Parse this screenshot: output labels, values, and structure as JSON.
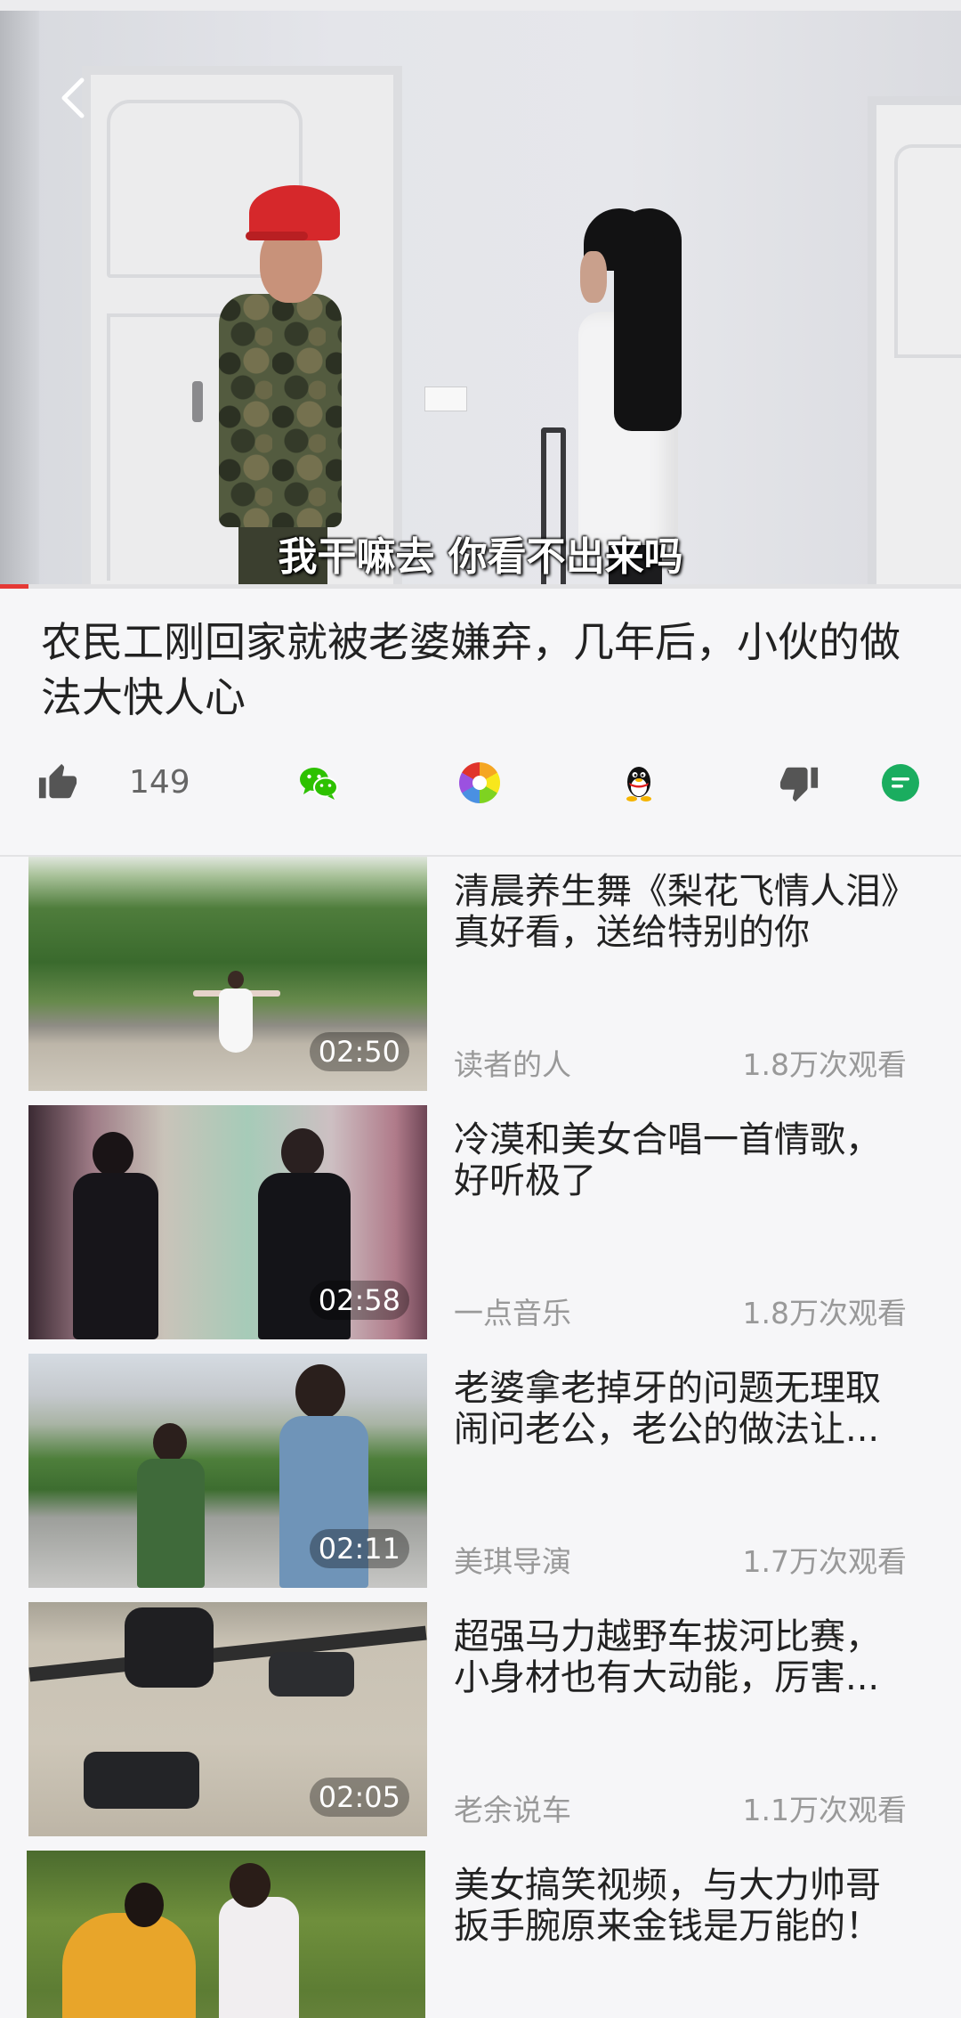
{
  "colors": {
    "accent": "#e53935",
    "wechat": "#2dc100",
    "comment": "#1aad5f",
    "title_text": "#222222",
    "meta_text": "#999999",
    "background": "#f6f6f8"
  },
  "player": {
    "back_icon": "chevron-left-icon",
    "subtitle": "我干嘛去 你看不出来吗",
    "progress": 0.03
  },
  "video": {
    "title": "农民工刚回家就被老婆嫌弃，几年后，小伙的做法大快人心",
    "like_count": "149"
  },
  "actions": {
    "like_icon": "thumbs-up-icon",
    "share_icons": [
      "wechat-icon",
      "moments-icon",
      "qq-icon"
    ],
    "dislike_icon": "thumbs-down-icon",
    "comment_icon": "comment-icon"
  },
  "related": [
    {
      "title": "清晨养生舞《梨花飞情人泪》真好看，送给特别的你",
      "author": "读者的人",
      "views": "1.8万次观看",
      "duration": "02:50"
    },
    {
      "title": "冷漠和美女合唱一首情歌，好听极了",
      "author": "一点音乐",
      "views": "1.8万次观看",
      "duration": "02:58"
    },
    {
      "title": "老婆拿老掉牙的问题无理取闹问老公，老公的做法让...",
      "author": "美琪导演",
      "views": "1.7万次观看",
      "duration": "02:11"
    },
    {
      "title": "超强马力越野车拔河比赛，小身材也有大动能，厉害...",
      "author": "老余说车",
      "views": "1.1万次观看",
      "duration": "02:05"
    },
    {
      "title": "美女搞笑视频，与大力帅哥扳手腕原来金钱是万能的！"
    }
  ]
}
